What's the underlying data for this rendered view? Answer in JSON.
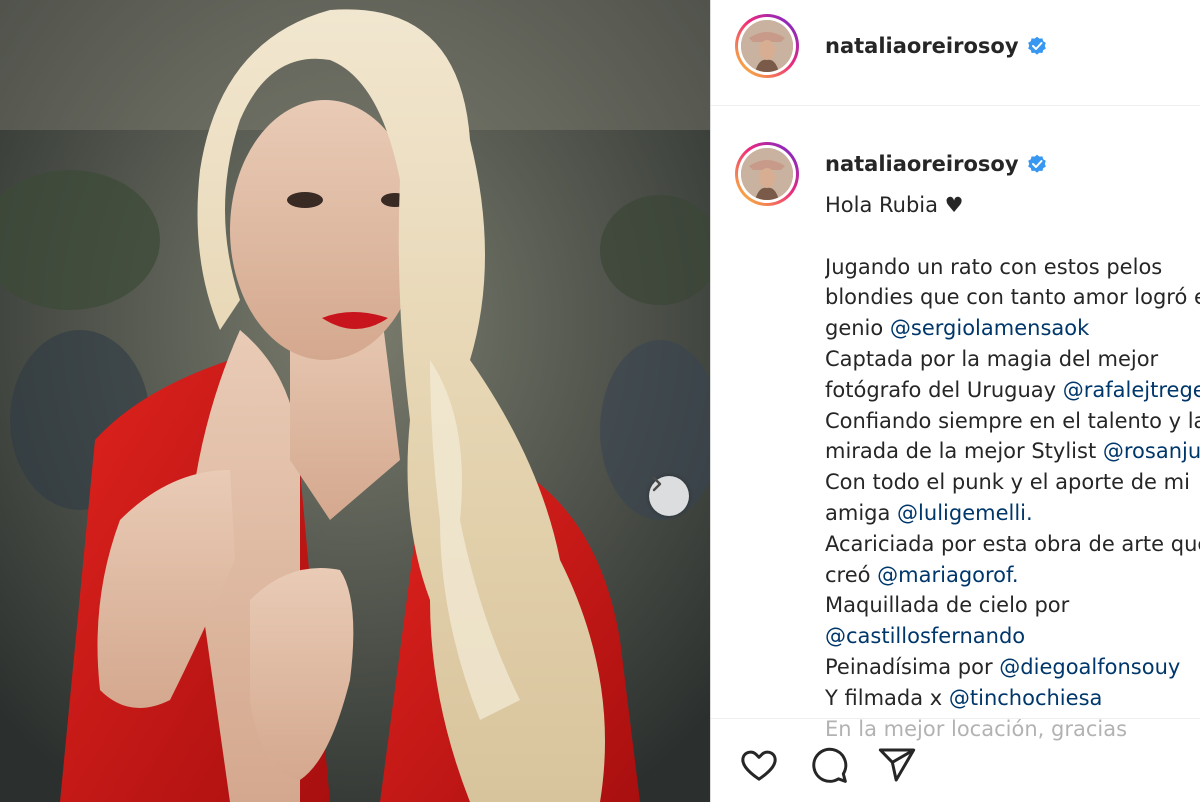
{
  "post": {
    "username": "nataliaoreirosoy",
    "verified_icon": "verified-badge-icon",
    "accent_verified": "#3897f0",
    "link_color": "#00376b"
  },
  "caption": {
    "first_line": "Hola Rubia ♥",
    "lines": [
      {
        "text": "Jugando un rato con estos pelos",
        "mention": ""
      },
      {
        "text": "blondies que con tanto amor logró e",
        "mention": ""
      },
      {
        "text": "genio ",
        "mention": "@sergiolamensaok"
      },
      {
        "text": "Captada por la magia del mejor",
        "mention": ""
      },
      {
        "text": "fotógrafo del Uruguay ",
        "mention": "@rafalejtregers"
      },
      {
        "text": "Confiando siempre en el talento y la",
        "mention": ""
      },
      {
        "text": "mirada de la mejor Stylist ",
        "mention": "@rosanjuan"
      },
      {
        "text": "Con todo el punk y el aporte de mi",
        "mention": ""
      },
      {
        "text": "amiga ",
        "mention": "@luligemelli."
      },
      {
        "text": "Acariciada por esta obra de arte que",
        "mention": ""
      },
      {
        "text": "creó ",
        "mention": "@mariagorof."
      },
      {
        "text": "Maquillada de cielo por",
        "mention": ""
      },
      {
        "text": "",
        "mention": "@castillosfernando"
      },
      {
        "text": "Peinadísima por ",
        "mention": "@diegoalfonsouy"
      },
      {
        "text": "Y filmada x ",
        "mention": "@tinchochiesa"
      },
      {
        "text": "En la mejor locación, gracias",
        "mention": ""
      }
    ]
  },
  "actions": {
    "like_icon": "heart-icon",
    "comment_icon": "comment-icon",
    "share_icon": "share-icon"
  },
  "carousel": {
    "next_icon": "chevron-right-icon"
  }
}
